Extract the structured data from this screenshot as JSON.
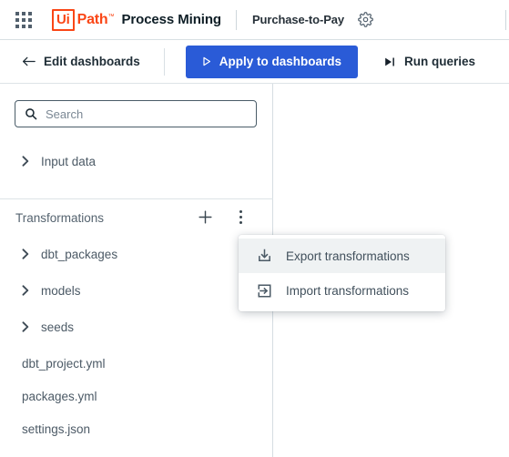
{
  "header": {
    "apps_icon": "apps-grid-icon",
    "logo": {
      "box_text": "Ui",
      "word": "Path",
      "tm": "™"
    },
    "product": "Process Mining",
    "project": "Purchase-to-Pay",
    "settings_icon": "gear-icon",
    "accent_orange": "#fa4616",
    "title_color": "#0e1e26"
  },
  "toolbar": {
    "edit_dashboards": "Edit dashboards",
    "edit_icon": "arrow-left-icon",
    "apply_dashboards": "Apply to dashboards",
    "apply_icon": "play-triangle-icon",
    "apply_bg": "#2a5bd7",
    "run_queries": "Run queries",
    "run_icon": "play-to-end-icon"
  },
  "sidebar": {
    "search": {
      "value": "",
      "placeholder": "Search",
      "icon": "search-icon"
    },
    "input_data": {
      "label": "Input data",
      "icon": "chevron-right-icon"
    },
    "transformations": {
      "title": "Transformations",
      "add_icon": "plus-icon",
      "more_icon": "kebab-vertical-icon"
    },
    "folders": [
      {
        "label": "dbt_packages",
        "icon": "chevron-right-icon"
      },
      {
        "label": "models",
        "icon": "chevron-right-icon"
      },
      {
        "label": "seeds",
        "icon": "chevron-right-icon"
      }
    ],
    "files": [
      {
        "label": "dbt_project.yml"
      },
      {
        "label": "packages.yml"
      },
      {
        "label": "settings.json"
      }
    ]
  },
  "context_menu": {
    "items": [
      {
        "label": "Export transformations",
        "icon": "download-tray-icon",
        "hovered": true
      },
      {
        "label": "Import transformations",
        "icon": "arrow-into-box-icon",
        "hovered": false
      }
    ],
    "hover_bg": "#eff2f3"
  }
}
